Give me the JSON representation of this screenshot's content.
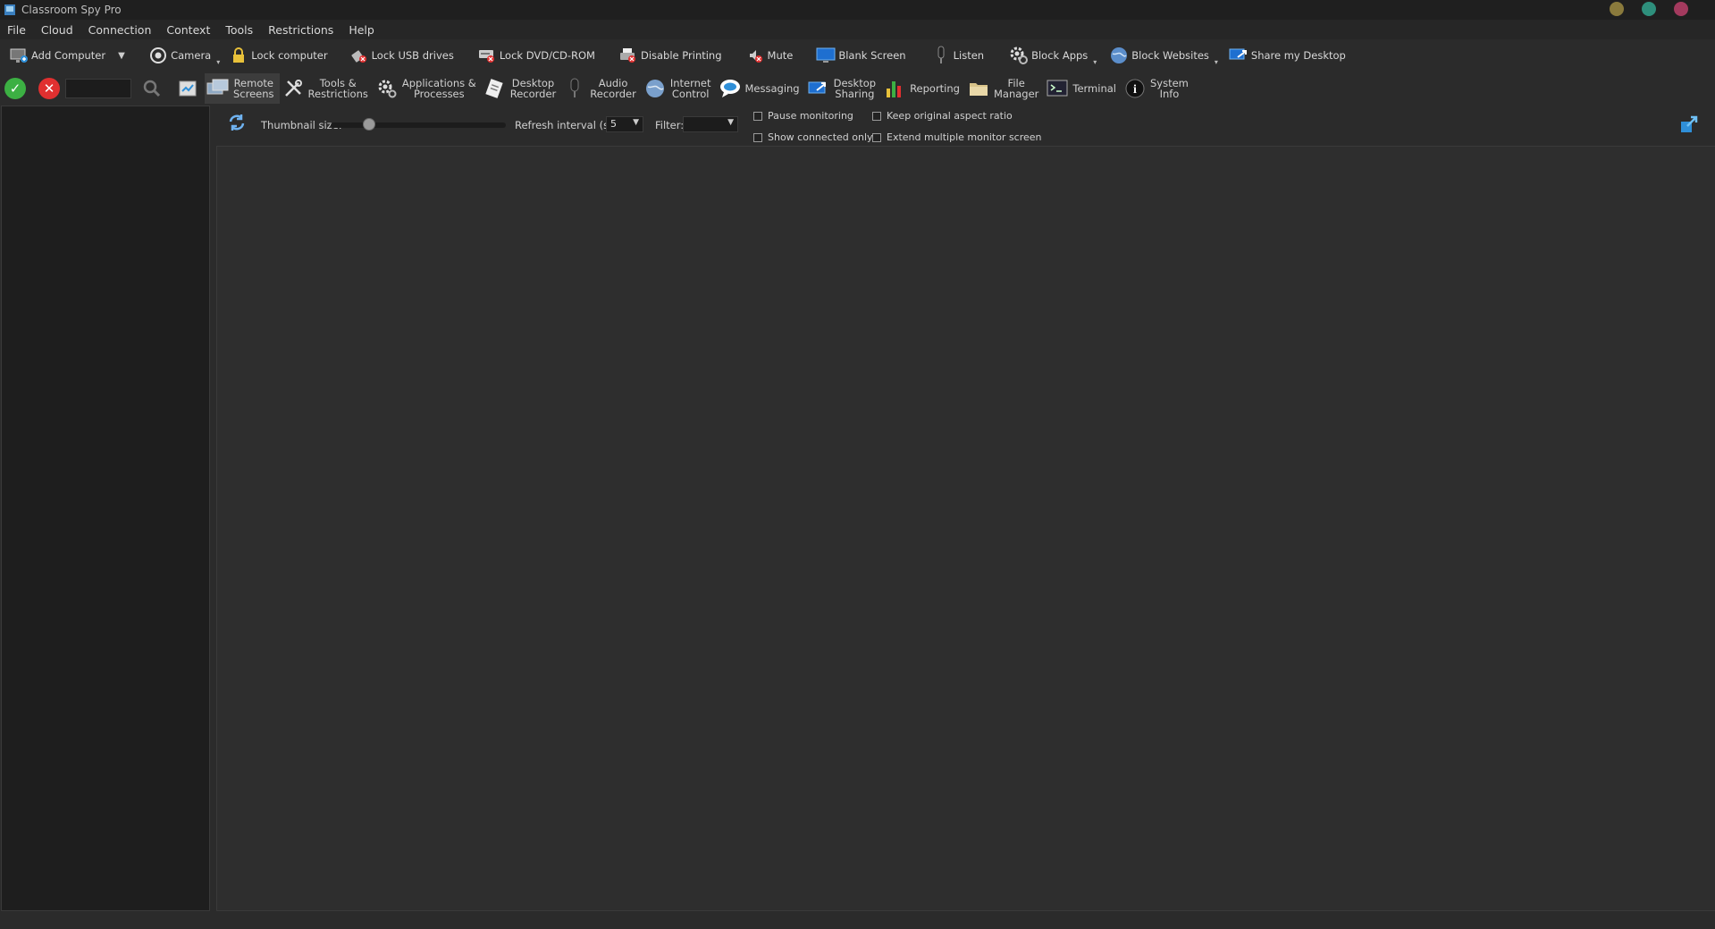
{
  "window": {
    "title": "Classroom Spy Pro",
    "controls": [
      {
        "name": "minimize",
        "color": "#8a7a3c"
      },
      {
        "name": "maximize",
        "color": "#2e8f7c"
      },
      {
        "name": "close",
        "color": "#a33a5e"
      }
    ]
  },
  "menu": [
    "File",
    "Cloud",
    "Connection",
    "Context",
    "Tools",
    "Restrictions",
    "Help"
  ],
  "toolbar1": {
    "add_computer": "Add Computer",
    "camera": "Camera",
    "lock_computer": "Lock computer",
    "lock_usb": "Lock USB drives",
    "lock_dvd": "Lock DVD/CD-ROM",
    "disable_printing": "Disable Printing",
    "mute": "Mute",
    "blank_screen": "Blank Screen",
    "listen": "Listen",
    "block_apps": "Block Apps",
    "block_websites": "Block Websites",
    "share_desktop": "Share my Desktop"
  },
  "toolbar2": {
    "search_value": "",
    "remote_screens": "Remote\nScreens",
    "tools_restrictions": "Tools &\nRestrictions",
    "apps_processes": "Applications &\nProcesses",
    "desktop_recorder": "Desktop\nRecorder",
    "audio_recorder": "Audio\nRecorder",
    "internet_control": "Internet\nControl",
    "messaging": "Messaging",
    "desktop_sharing": "Desktop\nSharing",
    "reporting": "Reporting",
    "file_manager": "File\nManager",
    "terminal": "Terminal",
    "system_info": "System\nInfo"
  },
  "controls": {
    "thumbnail_label": "Thumbnail size:",
    "thumbnail_level": 0.2,
    "refresh_label": "Refresh interval (s):",
    "refresh_value": "5",
    "filter_label": "Filter:",
    "filter_value": "",
    "pause_monitoring": "Pause monitoring",
    "show_connected": "Show connected only",
    "keep_aspect": "Keep original aspect ratio",
    "extend_monitor": "Extend multiple monitor screen"
  },
  "colors": {
    "accent_blue": "#2f8fd8",
    "ok_green": "#3cb043",
    "cancel_red": "#e03030"
  }
}
